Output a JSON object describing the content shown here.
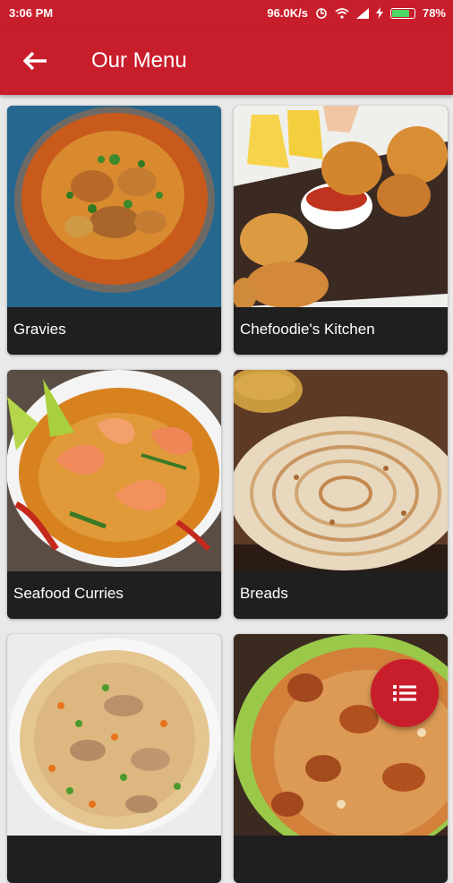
{
  "status": {
    "time": "3:06 PM",
    "speed": "96.0K/s",
    "battery": "78%"
  },
  "appbar": {
    "title": "Our Menu"
  },
  "menu": [
    {
      "label": "Gravies"
    },
    {
      "label": "Chefoodie's Kitchen"
    },
    {
      "label": "Seafood Curries"
    },
    {
      "label": "Breads"
    },
    {
      "label": ""
    },
    {
      "label": ""
    }
  ],
  "colors": {
    "primary": "#c81e2c",
    "card_label_bg": "#1f1f1f"
  },
  "icons": {
    "back": "arrow-left-icon",
    "fab": "list-icon"
  }
}
